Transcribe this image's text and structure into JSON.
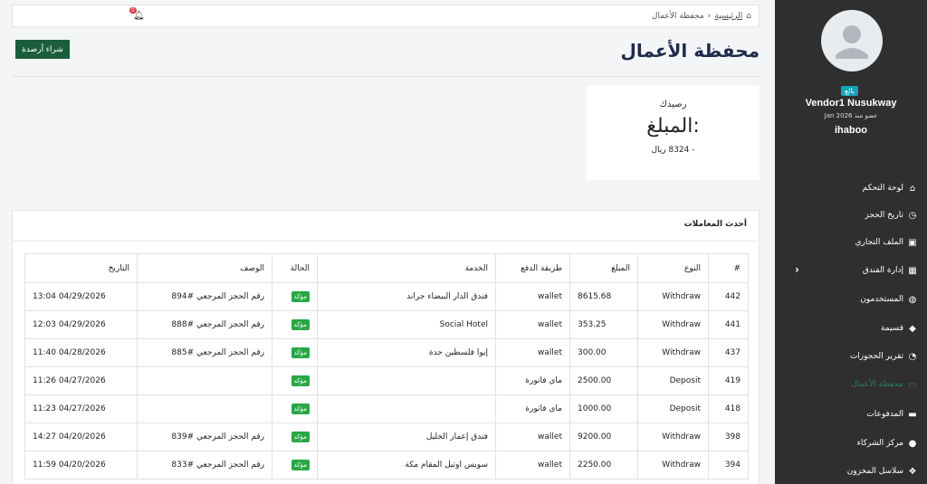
{
  "topbar": {
    "home_label": "الرئيسية",
    "sep": "‹",
    "current": "محفظة الأعمال",
    "notif_count": "0"
  },
  "buy_button": "شراء أرصدة",
  "page_title": "محفظة الأعمال",
  "balance": {
    "label": "رصيدك",
    "heading": ":المبلغ",
    "amount": "- 8324 ريال"
  },
  "transactions": {
    "title": "أحدث المعاملات",
    "columns": [
      "#",
      "النوع",
      "المبلغ",
      "طريقة الدفع",
      "الخدمة",
      "الحالة",
      "الوصف",
      "التاريخ"
    ],
    "rows": [
      {
        "id": "442",
        "type": "Withdraw",
        "amount": "8615.68",
        "method": "wallet",
        "service": "فندق الدار البيضاء جراند",
        "status": "مؤكد",
        "desc": "رقم الحجز المرجعي #894",
        "date": "04/29/2026 13:04"
      },
      {
        "id": "441",
        "type": "Withdraw",
        "amount": "353.25",
        "method": "wallet",
        "service": "Social Hotel",
        "status": "مؤكد",
        "desc": "رقم الحجز المرجعي #888",
        "date": "04/29/2026 12:03"
      },
      {
        "id": "437",
        "type": "Withdraw",
        "amount": "300.00",
        "method": "wallet",
        "service": "إيوا فلسطين جدة",
        "status": "مؤكد",
        "desc": "رقم الحجز المرجعي #885",
        "date": "04/28/2026 11:40"
      },
      {
        "id": "419",
        "type": "Deposit",
        "amount": "2500.00",
        "method": "ماي فاتورة",
        "service": "",
        "status": "مؤكد",
        "desc": "",
        "date": "04/27/2026 11:26"
      },
      {
        "id": "418",
        "type": "Deposit",
        "amount": "1000.00",
        "method": "ماي فاتورة",
        "service": "",
        "status": "مؤكد",
        "desc": "",
        "date": "04/27/2026 11:23"
      },
      {
        "id": "398",
        "type": "Withdraw",
        "amount": "9200.00",
        "method": "wallet",
        "service": "فندق إعمار الخليل",
        "status": "مؤكد",
        "desc": "رقم الحجز المرجعي #839",
        "date": "04/20/2026 14:27"
      },
      {
        "id": "394",
        "type": "Withdraw",
        "amount": "2250.00",
        "method": "wallet",
        "service": "سويس اوتيل المقام مكة",
        "status": "مؤكد",
        "desc": "رقم الحجز المرجعي #833",
        "date": "04/20/2026 11:59"
      }
    ]
  },
  "sidebar": {
    "role": "بائع",
    "vendor_name": "Vendor1 Nusukway",
    "member_since": "عضو منذ Jan 2026",
    "username": "ihaboo",
    "items": [
      {
        "label": "لوحة التحكم",
        "icon": "home-icon"
      },
      {
        "label": "تاريخ الحجز",
        "icon": "clock-icon"
      },
      {
        "label": "الملف التجاري",
        "icon": "briefcase-icon"
      },
      {
        "label": "إدارة الفندق",
        "icon": "building-icon"
      },
      {
        "label": "المستخدمون",
        "icon": "globe-icon"
      },
      {
        "label": "قسيمة",
        "icon": "tag-icon"
      },
      {
        "label": "تقرير الحجوزات",
        "icon": "chart-icon"
      },
      {
        "label": "محفظة الأعمال",
        "icon": "wallet-icon"
      },
      {
        "label": "المدفوعات",
        "icon": "card-icon"
      },
      {
        "label": "مركز الشركاء",
        "icon": "user-icon"
      },
      {
        "label": "سلاسل المخزون",
        "icon": "cubes-icon"
      }
    ]
  },
  "colors": {
    "sidebar": "#2f2f2f",
    "accent": "#1b5e3b",
    "badge": "#28a745",
    "active": "#2e7d5b"
  }
}
